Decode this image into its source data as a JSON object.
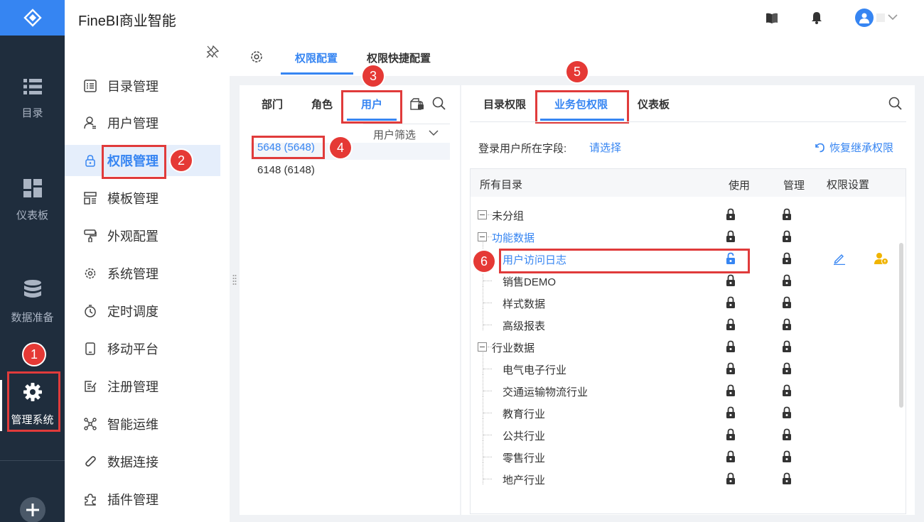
{
  "header": {
    "app_title": "FineBI商业智能"
  },
  "rail": [
    {
      "id": "catalog",
      "label": "目录"
    },
    {
      "id": "dashboard",
      "label": "仪表板"
    },
    {
      "id": "data-prep",
      "label": "数据准备"
    },
    {
      "id": "admin",
      "label": "管理系统"
    }
  ],
  "sidebar": [
    {
      "label": "目录管理",
      "icon": "list-doc-icon"
    },
    {
      "label": "用户管理",
      "icon": "user-icon"
    },
    {
      "label": "权限管理",
      "icon": "lock-icon"
    },
    {
      "label": "模板管理",
      "icon": "template-icon"
    },
    {
      "label": "外观配置",
      "icon": "brush-icon"
    },
    {
      "label": "系统管理",
      "icon": "gear-icon"
    },
    {
      "label": "定时调度",
      "icon": "timer-icon"
    },
    {
      "label": "移动平台",
      "icon": "mobile-icon"
    },
    {
      "label": "注册管理",
      "icon": "register-icon"
    },
    {
      "label": "智能运维",
      "icon": "ops-icon"
    },
    {
      "label": "数据连接",
      "icon": "link-icon"
    },
    {
      "label": "插件管理",
      "icon": "plugin-icon"
    }
  ],
  "top_tabs": [
    "权限配置",
    "权限快捷配置"
  ],
  "left_panel": {
    "tabs": [
      "部门",
      "角色",
      "用户"
    ],
    "filter_label": "用户筛选",
    "users": [
      "5648 (5648)",
      "6148 (6148)"
    ]
  },
  "right_panel": {
    "tabs": [
      "目录权限",
      "业务包权限",
      "仪表板"
    ],
    "login_field_label": "登录用户所在字段:",
    "login_field_value": "请选择",
    "restore_label": "恢复继承权限",
    "columns": [
      "所有目录",
      "使用",
      "管理",
      "权限设置"
    ],
    "tree": [
      {
        "label": "未分组",
        "level": 0,
        "expand": true,
        "link": false,
        "open": false
      },
      {
        "label": "功能数据",
        "level": 0,
        "expand": true,
        "link": true,
        "open": false
      },
      {
        "label": "用户访问日志",
        "level": 1,
        "link": true,
        "open": true,
        "settings": true
      },
      {
        "label": "销售DEMO",
        "level": 1,
        "link": false,
        "open": false
      },
      {
        "label": "样式数据",
        "level": 1,
        "link": false,
        "open": false
      },
      {
        "label": "高级报表",
        "level": 1,
        "link": false,
        "open": false
      },
      {
        "label": "行业数据",
        "level": 0,
        "expand": true,
        "link": false,
        "open": false
      },
      {
        "label": "电气电子行业",
        "level": 1,
        "link": false,
        "open": false
      },
      {
        "label": "交通运输物流行业",
        "level": 1,
        "link": false,
        "open": false
      },
      {
        "label": "教育行业",
        "level": 1,
        "link": false,
        "open": false
      },
      {
        "label": "公共行业",
        "level": 1,
        "link": false,
        "open": false
      },
      {
        "label": "零售行业",
        "level": 1,
        "link": false,
        "open": false
      },
      {
        "label": "地产行业",
        "level": 1,
        "link": false,
        "open": false
      }
    ]
  },
  "badges": [
    "1",
    "2",
    "3",
    "4",
    "5",
    "6"
  ],
  "colors": {
    "accent": "#3685f2",
    "rail": "#1f2d3d",
    "marker": "#e53935"
  }
}
